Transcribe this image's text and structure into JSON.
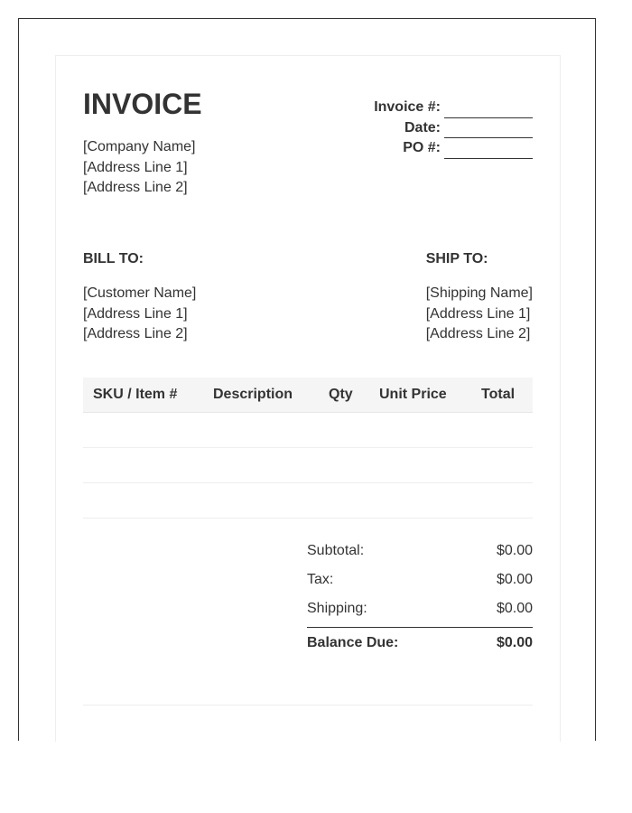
{
  "header": {
    "title": "INVOICE"
  },
  "company": {
    "name": "[Company Name]",
    "address_line_1": "[Address Line 1]",
    "address_line_2": "[Address Line 2]"
  },
  "meta": {
    "invoice_number_label": "Invoice #:",
    "date_label": "Date:",
    "po_label": "PO #:"
  },
  "bill_to": {
    "heading": "BILL TO:",
    "name": "[Customer Name]",
    "address_line_1": "[Address Line 1]",
    "address_line_2": "[Address Line 2]"
  },
  "ship_to": {
    "heading": "SHIP TO:",
    "name": "[Shipping Name]",
    "address_line_1": "[Address Line 1]",
    "address_line_2": "[Address Line 2]"
  },
  "items_table": {
    "columns": [
      "SKU / Item #",
      "Description",
      "Qty",
      "Unit Price",
      "Total"
    ]
  },
  "totals": {
    "subtotal_label": "Subtotal:",
    "subtotal_value": "$0.00",
    "tax_label": "Tax:",
    "tax_value": "$0.00",
    "shipping_label": "Shipping:",
    "shipping_value": "$0.00",
    "balance_label": "Balance Due:",
    "balance_value": "$0.00"
  }
}
